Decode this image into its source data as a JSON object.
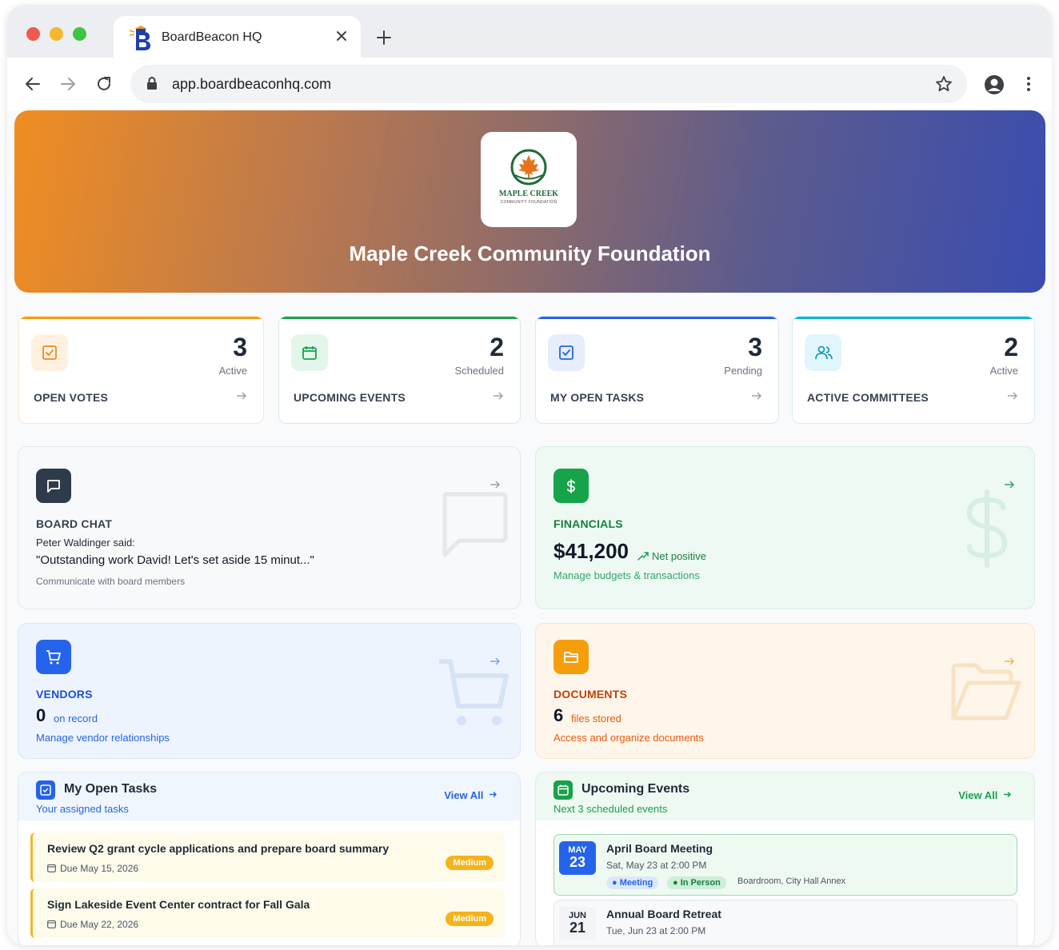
{
  "browser": {
    "tab_title": "BoardBeacon HQ",
    "url": "app.boardbeaconhq.com"
  },
  "hero": {
    "logo_title": "MAPLE CREEK",
    "logo_subtitle": "COMMUNITY FOUNDATION",
    "org_name": "Maple Creek Community Foundation"
  },
  "stats": [
    {
      "value": "3",
      "sub": "Active",
      "label": "OPEN VOTES",
      "accent": "#f59e0b",
      "icon": "check-square-icon"
    },
    {
      "value": "2",
      "sub": "Scheduled",
      "label": "UPCOMING EVENTS",
      "accent": "#16a34a",
      "icon": "calendar-icon"
    },
    {
      "value": "3",
      "sub": "Pending",
      "label": "MY OPEN TASKS",
      "accent": "#2563eb",
      "icon": "check-square-icon"
    },
    {
      "value": "2",
      "sub": "Active",
      "label": "ACTIVE COMMITTEES",
      "accent": "#06b6d4",
      "icon": "users-icon"
    }
  ],
  "board_chat": {
    "title": "BOARD CHAT",
    "author": "Peter Waldinger said:",
    "message": "\"Outstanding work David! Let's set aside 15 minut...\"",
    "description": "Communicate with board members"
  },
  "financials": {
    "title": "FINANCIALS",
    "amount": "$41,200",
    "trend": "Net positive",
    "description": "Manage budgets & transactions"
  },
  "vendors": {
    "title": "VENDORS",
    "count": "0",
    "count_label": "on record",
    "description": "Manage vendor relationships"
  },
  "documents": {
    "title": "DOCUMENTS",
    "count": "6",
    "count_label": "files stored",
    "description": "Access and organize documents"
  },
  "tasks_panel": {
    "title": "My Open Tasks",
    "subtitle": "Your assigned tasks",
    "view_all": "View All",
    "items": [
      {
        "title": "Review Q2 grant cycle applications and prepare board summary",
        "due": "Due May 15, 2026",
        "priority": "Medium"
      },
      {
        "title": "Sign Lakeside Event Center contract for Fall Gala",
        "due": "Due May 22, 2026",
        "priority": "Medium"
      }
    ]
  },
  "events_panel": {
    "title": "Upcoming Events",
    "subtitle": "Next 3 scheduled events",
    "view_all": "View All",
    "items": [
      {
        "month": "MAY",
        "day": "23",
        "title": "April Board Meeting",
        "time": "Sat, May 23 at 2:00 PM",
        "type": "Meeting",
        "mode": "In Person",
        "location": "Boardroom, City Hall Annex"
      },
      {
        "month": "JUN",
        "day": "21",
        "title": "Annual Board Retreat",
        "time": "Tue, Jun 23 at 2:00 PM"
      }
    ]
  }
}
